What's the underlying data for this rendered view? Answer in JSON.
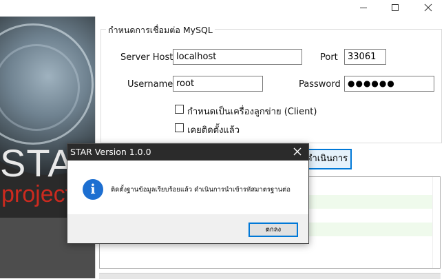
{
  "window": {
    "minimize_icon": "minimize-icon",
    "maximize_icon": "maximize-icon",
    "close_icon": "close-icon"
  },
  "banner": {
    "big_text": "STAR",
    "sub_text": "project"
  },
  "connection": {
    "group_title": "กำหนดการเชื่อมต่อ MySQL",
    "server_host_label": "Server Host",
    "server_host_value": "localhost",
    "port_label": "Port",
    "port_value": "33061",
    "username_label": "Username",
    "username_value": "root",
    "password_label": "Password",
    "password_masked": "●●●●●●",
    "client_checkbox_label": "กำหนดเป็นเครื่องลูกข่าย (Client)",
    "client_checked": false,
    "installed_checkbox_label": "เคยติดตั้งแล้ว",
    "installed_checked": false
  },
  "action_button_label": "ดำเนินการ",
  "colors": {
    "accent": "#0078d7",
    "dialog_title_bg": "#2b2b2b",
    "info_icon": "#1d6fd1",
    "log_row_bg": "#effaec",
    "brand_red": "#cc2a1f"
  },
  "dialog": {
    "title": "STAR Version 1.0.0",
    "icon": "info-icon",
    "message": "ติดตั้งฐานข้อมูลเรียบร้อยแล้ว ดำเนินการนำเข้ารหัสมาตรฐานต่อ",
    "ok_label": "ตกลง"
  }
}
